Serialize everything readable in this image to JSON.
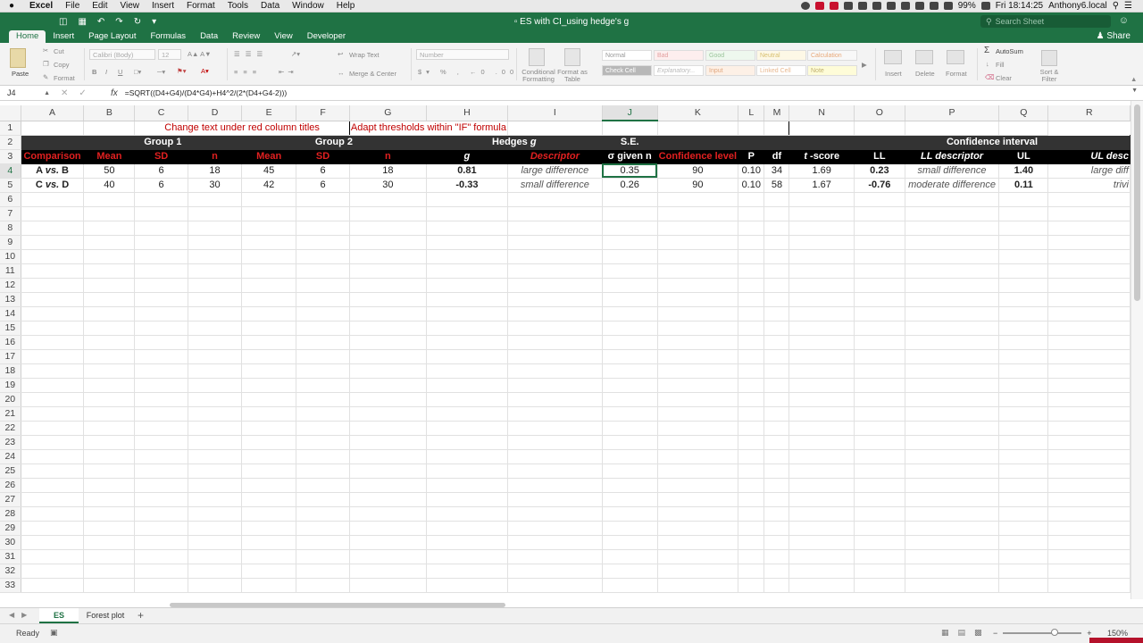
{
  "menubar": {
    "app": "Excel",
    "items": [
      "File",
      "Edit",
      "View",
      "Insert",
      "Format",
      "Tools",
      "Data",
      "Window",
      "Help"
    ],
    "battery": "99%",
    "clock": "Fri 18:14:25",
    "host": "Anthony6.local"
  },
  "window": {
    "title": "ES with CI_using hedge's g",
    "search_placeholder": "Search Sheet"
  },
  "ribbon": {
    "tabs": [
      "Home",
      "Insert",
      "Page Layout",
      "Formulas",
      "Data",
      "Review",
      "View",
      "Developer"
    ],
    "active_tab": "Home",
    "share": "Share",
    "paste": "Paste",
    "cut": "Cut",
    "copy": "Copy",
    "format": "Format",
    "font_name": "Calibri (Body)",
    "font_size": "12",
    "wrap_text": "Wrap Text",
    "merge_center": "Merge & Center",
    "number_format": "Number",
    "conditional_formatting": "Conditional Formatting",
    "format_as_table": "Format as Table",
    "styles": [
      "Normal",
      "Bad",
      "Good",
      "Neutral",
      "Calculation",
      "Check Cell",
      "Explanatory...",
      "Input",
      "Linked Cell",
      "Note"
    ],
    "insert": "Insert",
    "delete": "Delete",
    "format_cells": "Format",
    "autosum": "AutoSum",
    "fill": "Fill",
    "clear": "Clear",
    "sort_filter": "Sort & Filter"
  },
  "formula_bar": {
    "name_box": "J4",
    "formula": "=SQRT((D4+G4)/(D4*G4)+H4^2/(2*(D4+G4-2)))"
  },
  "columns": [
    "A",
    "B",
    "C",
    "D",
    "E",
    "F",
    "G",
    "H",
    "I",
    "J",
    "K",
    "L",
    "M",
    "N",
    "O",
    "P",
    "Q",
    "R"
  ],
  "selected_column": "J",
  "selected_row": 4,
  "sheet": {
    "r1": {
      "c": "Change text under red column titles",
      "h": "Adapt thresholds within \"IF\" formula"
    },
    "r2": {
      "group1": "Group 1",
      "group2": "Group 2",
      "hedges": "Hedges ",
      "hedges_g": "g",
      "se": "S.E.",
      "ci": "Confidence interval"
    },
    "r3": {
      "a": "Comparison",
      "b": "Mean",
      "c": "SD",
      "d": "n",
      "e": "Mean",
      "f": "SD",
      "g": "n",
      "h": "g",
      "i": "Descriptor",
      "j": "σ given n",
      "k": "Confidence level",
      "l": "P",
      "m": "df",
      "n_pre": "t",
      "n": " -score",
      "o": "LL",
      "p": "LL descriptor",
      "q": "UL",
      "r": "UL desc"
    },
    "r4": {
      "a1": "A ",
      "a2": "vs.",
      "a3": "  B",
      "b": "50",
      "c": "6",
      "d": "18",
      "e": "45",
      "f": "6",
      "g": "18",
      "h": "0.81",
      "i": "large difference",
      "j": "0.35",
      "k": "90",
      "l": "0.10",
      "m": "34",
      "n": "1.69",
      "o": "0.23",
      "p": "small difference",
      "q": "1.40",
      "r": "large diff"
    },
    "r5": {
      "a1": "C ",
      "a2": "vs.",
      "a3": "  D",
      "b": "40",
      "c": "6",
      "d": "30",
      "e": "42",
      "f": "6",
      "g": "30",
      "h": "-0.33",
      "i": "small difference",
      "j": "0.26",
      "k": "90",
      "l": "0.10",
      "m": "58",
      "n": "1.67",
      "o": "-0.76",
      "p": "moderate difference",
      "q": "0.11",
      "r": "trivi"
    }
  },
  "sheet_tabs": [
    "ES",
    "Forest plot"
  ],
  "active_sheet": "ES",
  "status": {
    "ready": "Ready",
    "zoom": "150%"
  },
  "colors": {
    "excel_green": "#1f7244",
    "title_red": "#c00000",
    "header_dark": "#333333"
  }
}
